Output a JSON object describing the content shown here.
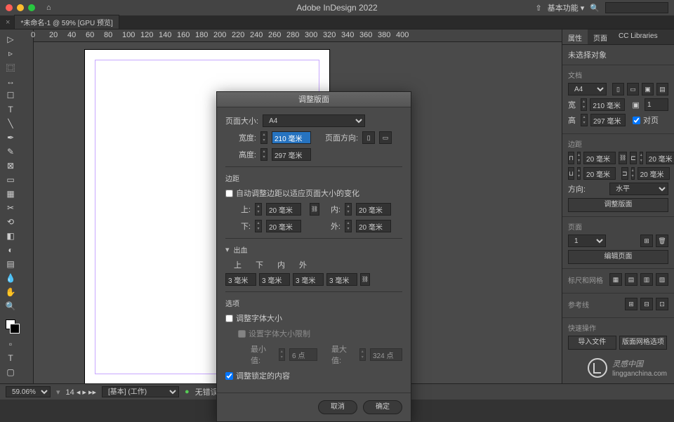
{
  "app": {
    "title": "Adobe InDesign 2022",
    "workspace": "基本功能"
  },
  "doc_tab": "*未命名-1 @ 59% [GPU 预览]",
  "ruler_ticks": [
    "0",
    "20",
    "40",
    "60",
    "80",
    "100",
    "120",
    "140",
    "160",
    "180",
    "200",
    "220",
    "240",
    "260",
    "280",
    "300",
    "320",
    "340",
    "360",
    "380",
    "400"
  ],
  "right_panel": {
    "tabs": [
      "属性",
      "页面",
      "CC Libraries"
    ],
    "no_selection": "未选择对象",
    "doc": {
      "title": "文档",
      "preset": "A4",
      "width_label": "宽",
      "width": "210 毫米",
      "height_label": "高",
      "height": "297 毫米",
      "facing_pages": "对页",
      "page_count": "1"
    },
    "margin": {
      "title": "边距",
      "top": "20 毫米",
      "bottom": "20 毫米",
      "inside": "20 毫米",
      "outside": "20 毫米"
    },
    "orientation": {
      "label": "方向:",
      "value": "水平"
    },
    "adjust_layout_btn": "调整版面",
    "page_sec": {
      "title": "页面",
      "current": "1",
      "edit_btn": "编辑页面"
    },
    "rulers": {
      "title": "标尺和网格"
    },
    "guides": {
      "title": "参考线"
    },
    "quick": {
      "title": "快速操作",
      "import_btn": "导入文件",
      "grid_btn": "版面网格选项"
    }
  },
  "dialog": {
    "title": "调整版面",
    "page_size": {
      "label": "页面大小:",
      "value": "A4"
    },
    "width": {
      "label": "宽度:",
      "value": "210 毫米"
    },
    "height": {
      "label": "高度:",
      "value": "297 毫米"
    },
    "orientation_label": "页面方向:",
    "margin": {
      "title": "边距",
      "auto_adjust": "自动调整边距以适应页面大小的变化",
      "top_label": "上:",
      "top": "20 毫米",
      "bottom_label": "下:",
      "bottom": "20 毫米",
      "inside_label": "内:",
      "inside": "20 毫米",
      "outside_label": "外:",
      "outside": "20 毫米"
    },
    "bleed": {
      "title": "出血",
      "headers": [
        "上",
        "下",
        "内",
        "外"
      ],
      "values": [
        "3 毫米",
        "3 毫米",
        "3 毫米",
        "3 毫米"
      ]
    },
    "options": {
      "title": "选项",
      "adjust_font": "调整字体大小",
      "font_limit": "设置字体大小限制",
      "min_label": "最小值:",
      "min": "6 点",
      "max_label": "最大值:",
      "max": "324 点",
      "adjust_locked": "调整锁定的内容"
    },
    "cancel": "取消",
    "ok": "确定"
  },
  "status": {
    "zoom": "59.06%",
    "layer": "[基本] (工作)",
    "errors": "无错误"
  },
  "watermark": {
    "zh": "灵感中国",
    "en": "lingganchina.com"
  }
}
